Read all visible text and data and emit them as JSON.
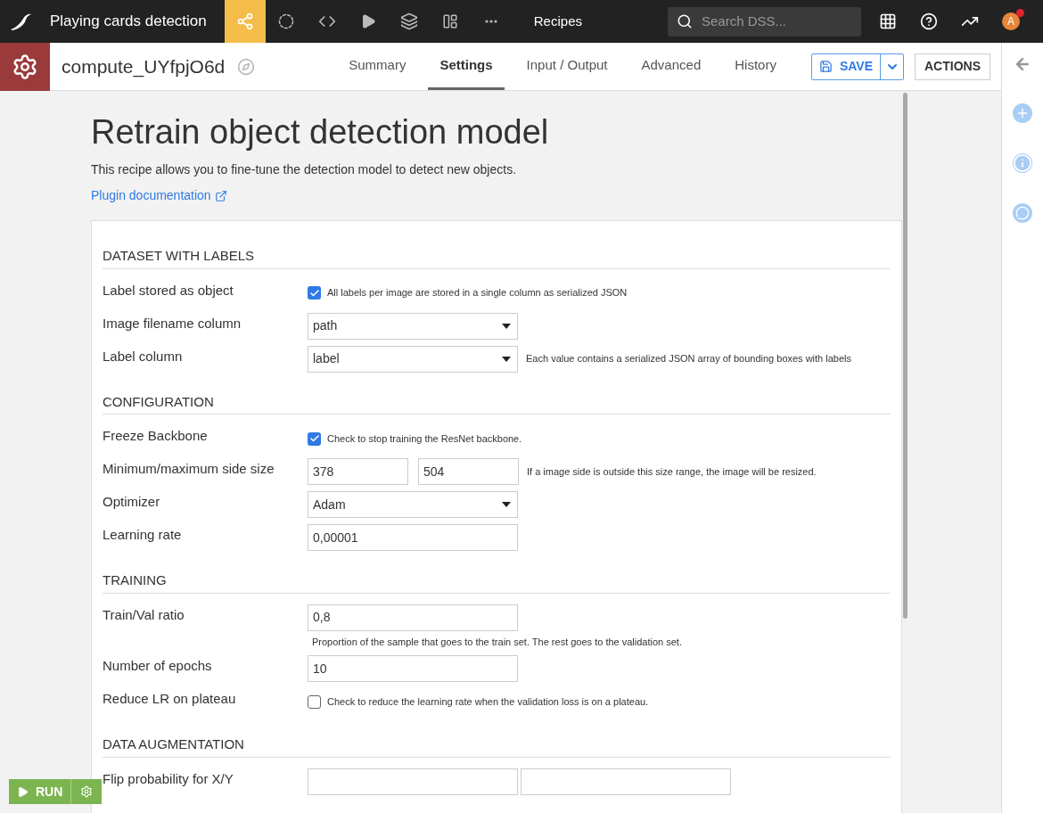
{
  "topbar": {
    "project": "Playing cards detection",
    "nav_icons": [
      {
        "kind": "flow",
        "selected": true
      },
      {
        "kind": "circle",
        "selected": false
      },
      {
        "kind": "code",
        "selected": false
      },
      {
        "kind": "play",
        "selected": false
      },
      {
        "kind": "stack",
        "selected": false
      },
      {
        "kind": "dashboard",
        "selected": false
      },
      {
        "kind": "more",
        "selected": false
      }
    ],
    "section": "Recipes",
    "search": {
      "placeholder": "Search DSS..."
    },
    "avatar": "A"
  },
  "recipe": {
    "name": "compute_UYfpjO6d",
    "tabs": [
      {
        "label": "Summary",
        "selected": false
      },
      {
        "label": "Settings",
        "selected": true
      },
      {
        "label": "Input / Output",
        "selected": false
      },
      {
        "label": "Advanced",
        "selected": false
      },
      {
        "label": "History",
        "selected": false
      }
    ],
    "save": "SAVE",
    "actions": "ACTIONS"
  },
  "page": {
    "title": "Retrain object detection model",
    "description": "This recipe allows you to fine-tune the detection model to detect new objects.",
    "link": "Plugin documentation"
  },
  "sections": [
    {
      "title": "DATASET WITH LABELS",
      "fields": [
        {
          "kind": "checkbox",
          "label": "Label stored as object",
          "checked": true,
          "help": "All labels per image are stored in a single column as serialized JSON"
        },
        {
          "kind": "select",
          "label": "Image filename column",
          "value": "path"
        },
        {
          "kind": "select",
          "label": "Label column",
          "value": "label",
          "help": "Each value contains a serialized JSON array of bounding boxes with labels"
        }
      ]
    },
    {
      "title": "CONFIGURATION",
      "fields": [
        {
          "kind": "checkbox",
          "label": "Freeze Backbone",
          "checked": true,
          "help": "Check to stop training the ResNet backbone."
        },
        {
          "kind": "pair",
          "label": "Minimum/maximum side size",
          "values": [
            "378",
            "504"
          ],
          "help": "If a image side is outside this size range, the image will be resized."
        },
        {
          "kind": "select",
          "label": "Optimizer",
          "value": "Adam"
        },
        {
          "kind": "text",
          "label": "Learning rate",
          "value": "0,00001"
        }
      ]
    },
    {
      "title": "TRAINING",
      "fields": [
        {
          "kind": "text",
          "label": "Train/Val ratio",
          "value": "0,8",
          "note": "Proportion of the sample that goes to the train set. The rest goes to the validation set."
        },
        {
          "kind": "text",
          "label": "Number of epochs",
          "value": "10"
        },
        {
          "kind": "checkbox",
          "label": "Reduce LR on plateau",
          "checked": false,
          "help": "Check to reduce the learning rate when the validation loss is on a plateau."
        }
      ]
    },
    {
      "title": "DATA AUGMENTATION",
      "fields": [
        {
          "kind": "pair",
          "label": "Flip probability for X/Y"
        }
      ]
    }
  ],
  "run": "RUN"
}
